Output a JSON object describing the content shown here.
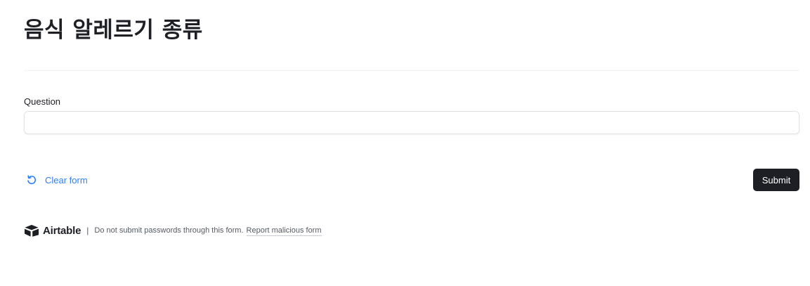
{
  "form": {
    "title": "음식 알레르기 종류",
    "field": {
      "label": "Question",
      "value": "",
      "placeholder": ""
    },
    "actions": {
      "clear_label": "Clear form",
      "submit_label": "Submit"
    }
  },
  "footer": {
    "brand_name": "Airtable",
    "separator": "|",
    "note": "Do not submit passwords through this form.",
    "report_link": "Report malicious form"
  },
  "colors": {
    "accent_link": "#2d7ff9",
    "primary_button": "#1d1f25",
    "text": "#1d1f25",
    "muted_text": "#555a66"
  },
  "icons": {
    "clear": "refresh-ccw-icon",
    "brand": "airtable-logo-icon"
  }
}
